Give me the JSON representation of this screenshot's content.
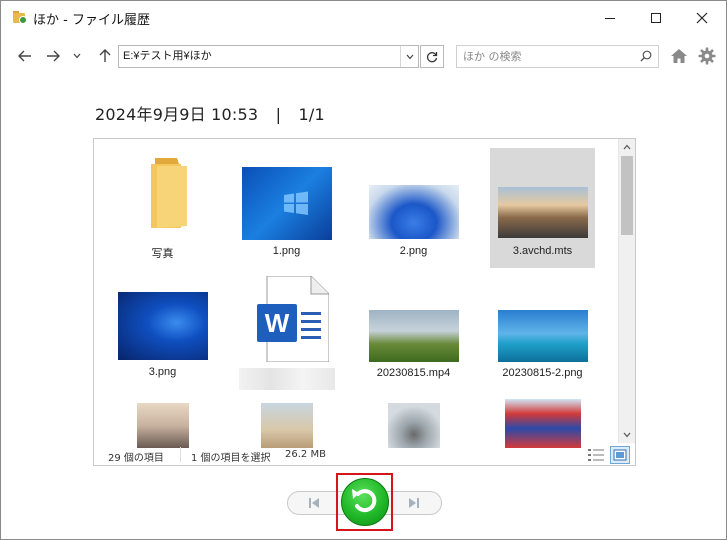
{
  "window": {
    "title": "ほか - ファイル履歴",
    "controls": {
      "minimize": "minimize",
      "maximize": "maximize",
      "close": "×"
    }
  },
  "nav": {
    "address": "E:¥テスト用¥ほか",
    "search_placeholder": "ほか の検索"
  },
  "header": {
    "date": "2024年9月9日 10:53",
    "separator": "|",
    "page": "1/1"
  },
  "files": [
    {
      "name": "写真",
      "kind": "folder"
    },
    {
      "name": "1.png",
      "kind": "image"
    },
    {
      "name": "2.png",
      "kind": "image"
    },
    {
      "name": "3.avchd.mts",
      "kind": "video",
      "selected": true
    },
    {
      "name": "3.png",
      "kind": "image"
    },
    {
      "name": "",
      "kind": "word-document"
    },
    {
      "name": "20230815.mp4",
      "kind": "video"
    },
    {
      "name": "20230815-2.png",
      "kind": "image"
    },
    {
      "name": "",
      "kind": "image"
    },
    {
      "name": "",
      "kind": "image"
    },
    {
      "name": "",
      "kind": "image"
    },
    {
      "name": "",
      "kind": "image"
    }
  ],
  "status": {
    "count": "29 個の項目",
    "selection": "1 個の項目を選択",
    "size": "26.2 MB"
  },
  "colors": {
    "accent_blue": "#0078d7",
    "restore_green": "#20b828",
    "highlight_red": "#d5151a",
    "selected_bg": "#d9d9d9"
  },
  "icons": {
    "back": "arrow-left-icon",
    "forward": "arrow-right-icon",
    "recent": "chevron-down-icon",
    "up": "arrow-up-icon",
    "refresh": "refresh-icon",
    "search": "search-icon",
    "home": "home-icon",
    "settings": "gear-icon",
    "previous": "previous-version-icon",
    "restore": "restore-icon",
    "next": "next-version-icon"
  }
}
